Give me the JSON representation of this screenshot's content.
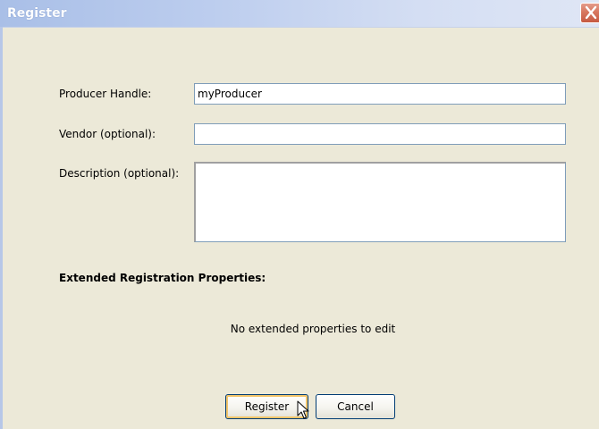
{
  "window": {
    "title": "Register",
    "close_icon": "close-icon"
  },
  "form": {
    "producer_handle": {
      "label": "Producer Handle:",
      "value": "myProducer"
    },
    "vendor": {
      "label": "Vendor (optional):",
      "value": ""
    },
    "description": {
      "label": "Description (optional):",
      "value": ""
    }
  },
  "extended": {
    "heading": "Extended Registration Properties:",
    "empty_message": "No extended properties to edit"
  },
  "buttons": {
    "register_label": "Register",
    "cancel_label": "Cancel"
  },
  "colors": {
    "titlebar": "#bccdee",
    "dialog_background": "#ece9d8",
    "close_button": "#d7775f",
    "field_border": "#7f9db9",
    "button_border": "#003c74"
  },
  "pointer": "arrow-cursor-icon"
}
